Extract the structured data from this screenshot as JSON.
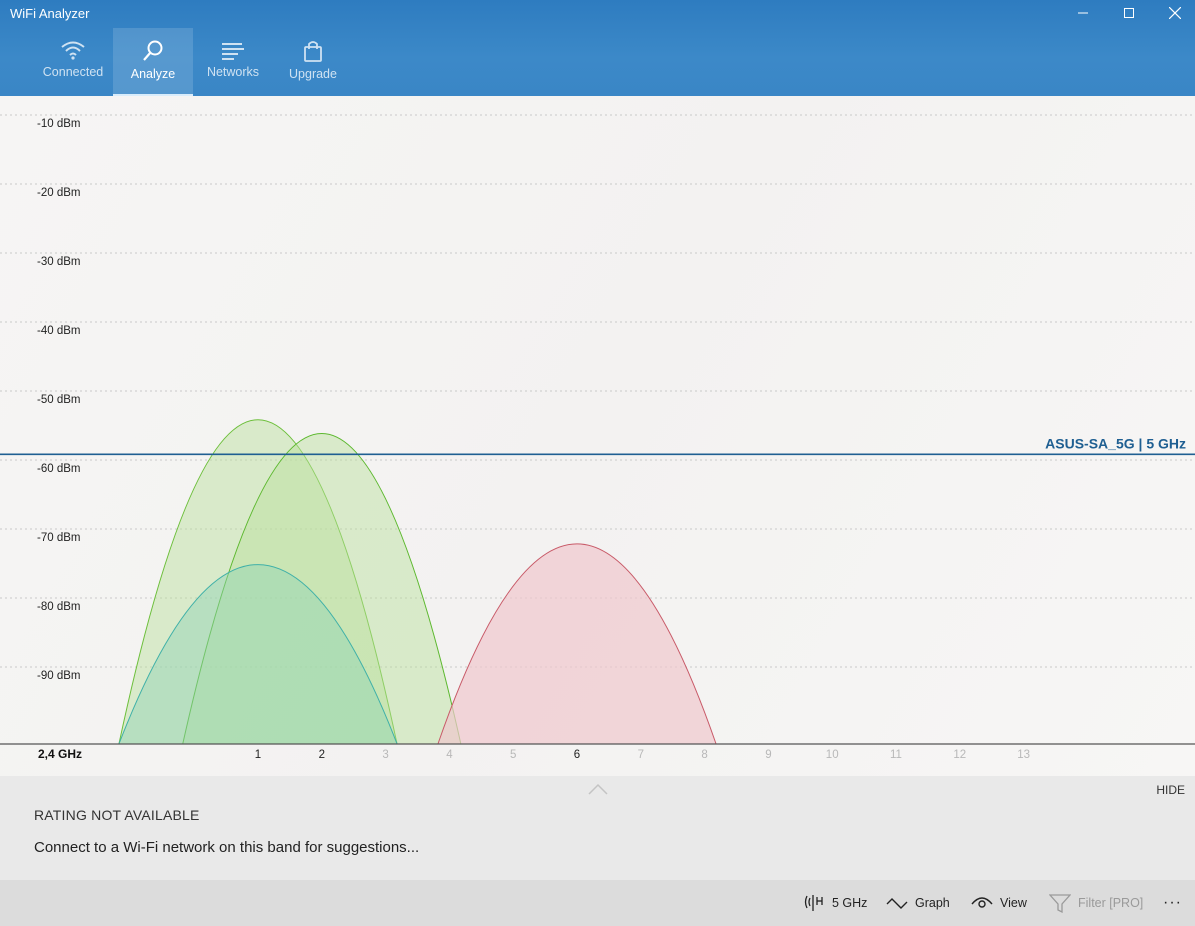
{
  "window": {
    "title": "WiFi Analyzer",
    "minimize": "—",
    "maximize": "☐",
    "close": "✕"
  },
  "nav": [
    {
      "label": "Connected",
      "icon": "wifi-icon",
      "active": false
    },
    {
      "label": "Analyze",
      "icon": "search-icon",
      "active": true
    },
    {
      "label": "Networks",
      "icon": "list-icon",
      "active": false
    },
    {
      "label": "Upgrade",
      "icon": "bag-icon",
      "active": false
    }
  ],
  "chart_data": {
    "type": "area",
    "band": "2,4 GHz",
    "y_tick_labels": [
      "-10 dBm",
      "-20 dBm",
      "-30 dBm",
      "-40 dBm",
      "-50 dBm",
      "-60 dBm",
      "-70 dBm",
      "-80 dBm",
      "-90 dBm"
    ],
    "y_values": [
      -10,
      -20,
      -30,
      -40,
      -50,
      -60,
      -70,
      -80,
      -90
    ],
    "ylim": [
      -100,
      -5
    ],
    "channels": [
      1,
      2,
      3,
      4,
      5,
      6,
      7,
      8,
      9,
      10,
      11,
      12,
      13
    ],
    "active_channels": [
      1,
      2,
      6
    ],
    "reference_line": {
      "label": "ASUS-SA_5G | 5 GHz",
      "dbm": -57,
      "color": "#1f5f92"
    },
    "series": [
      {
        "center": 1,
        "width": 4,
        "peak": -53,
        "stroke": "#6cbf3a",
        "fill": "#b9df98",
        "opacity": 0.45
      },
      {
        "center": 2,
        "width": 4,
        "peak": -55,
        "stroke": "#5cb82e",
        "fill": "#b7e09a",
        "opacity": 0.45
      },
      {
        "center": 1,
        "width": 4,
        "peak": -74,
        "stroke": "#3fb0a8",
        "fill": "#8fd3b4",
        "opacity": 0.45
      },
      {
        "center": 6,
        "width": 4,
        "peak": -71,
        "stroke": "#c85a68",
        "fill": "#efc7cd",
        "opacity": 0.7
      }
    ],
    "grid": true
  },
  "panel": {
    "rating": "RATING NOT AVAILABLE",
    "suggestion": "Connect to a Wi-Fi network on this band for suggestions...",
    "hide": "HIDE"
  },
  "commands": {
    "band": "5 GHz",
    "graph": "Graph",
    "view": "View",
    "filter": "Filter [PRO]",
    "more": "···"
  }
}
